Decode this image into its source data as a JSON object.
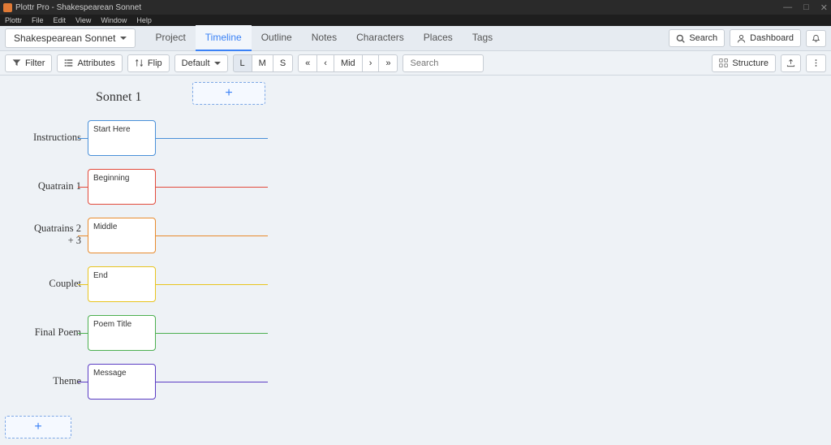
{
  "app": {
    "title": "Plottr Pro - Shakespearean Sonnet",
    "menus": [
      "Plottr",
      "File",
      "Edit",
      "View",
      "Window",
      "Help"
    ],
    "win_min": "—",
    "win_max": "□",
    "win_close": "✕"
  },
  "project_selector": "Shakespearean Sonnet",
  "tabs": [
    "Project",
    "Timeline",
    "Outline",
    "Notes",
    "Characters",
    "Places",
    "Tags"
  ],
  "active_tab": 1,
  "top_right": {
    "search": "Search",
    "dashboard": "Dashboard"
  },
  "toolbar": {
    "filter": "Filter",
    "attributes": "Attributes",
    "flip": "Flip",
    "default": "Default",
    "sizes": [
      "L",
      "M",
      "S"
    ],
    "active_size": 0,
    "nav": [
      "«",
      "‹",
      "Mid",
      "›",
      "»"
    ],
    "search_placeholder": "Search",
    "structure": "Structure"
  },
  "timeline": {
    "column": "Sonnet 1",
    "rows": [
      {
        "label": "Instructions",
        "card": "Start Here",
        "color": "#4a90d9"
      },
      {
        "label": "Quatrain 1",
        "card": "Beginning",
        "color": "#e24a3b"
      },
      {
        "label": "Quatrains 2 + 3",
        "card": "Middle",
        "color": "#e88b2d"
      },
      {
        "label": "Couplet",
        "card": "End",
        "color": "#e8c41f"
      },
      {
        "label": "Final Poem",
        "card": "Poem Title",
        "color": "#4caf50"
      },
      {
        "label": "Theme",
        "card": "Message",
        "color": "#5b3cc4"
      }
    ],
    "plus": "+"
  }
}
